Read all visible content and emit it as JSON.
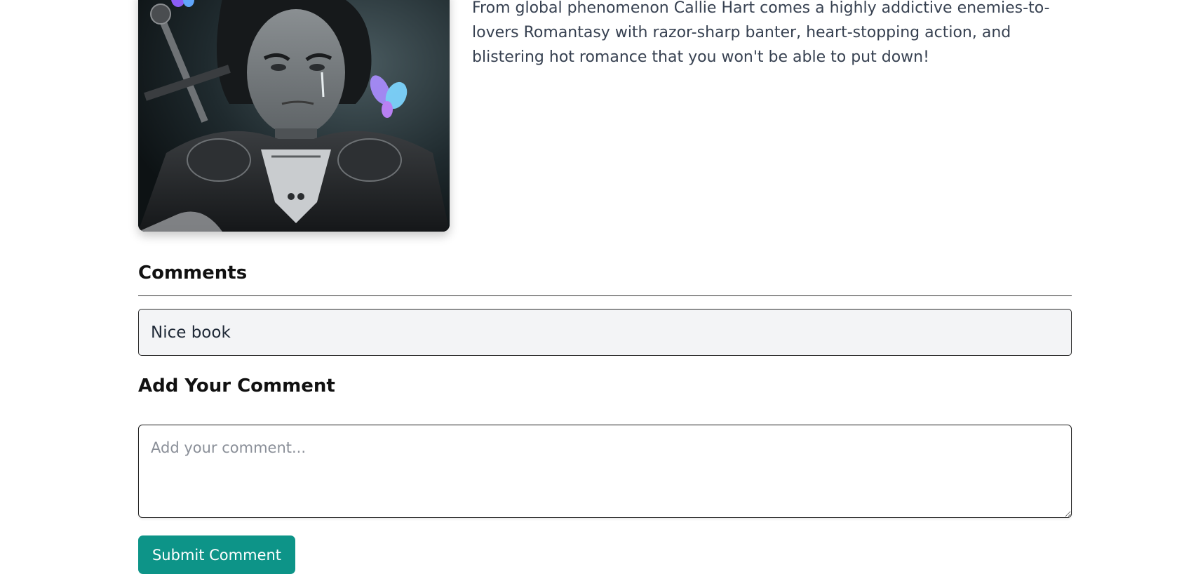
{
  "book": {
    "description": "From global phenomenon Callie Hart comes a highly addictive enemies-to-lovers Romantasy with razor-sharp banter, heart-stopping action, and blistering hot romance that you won't be able to put down!",
    "cover_icon": "book-cover-image"
  },
  "comments": {
    "heading": "Comments",
    "items": [
      {
        "text": "Nice book"
      }
    ]
  },
  "add_comment": {
    "heading": "Add Your Comment",
    "placeholder": "Add your comment...",
    "value": "",
    "submit_label": "Submit Comment"
  },
  "colors": {
    "accent": "#0d9488",
    "comment_bg": "#f3f4f6",
    "body_text": "#374151"
  }
}
